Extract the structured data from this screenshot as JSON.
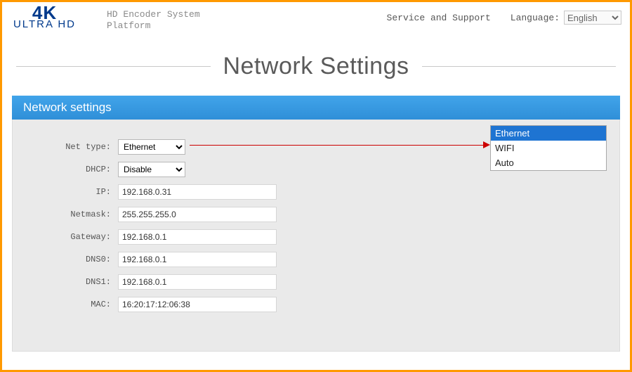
{
  "header": {
    "logo_top": "4K",
    "logo_bottom": "ULTRA HD",
    "platform_line1": "HD Encoder System",
    "platform_line2": "Platform",
    "service_link": "Service and Support",
    "language_label": "Language:",
    "language_value": "English"
  },
  "page_title": "Network Settings",
  "section_title": "Network settings",
  "form": {
    "net_type_label": "Net type:",
    "net_type_value": "Ethernet",
    "dhcp_label": "DHCP:",
    "dhcp_value": "Disable",
    "ip_label": "IP:",
    "ip_value": "192.168.0.31",
    "netmask_label": "Netmask:",
    "netmask_value": "255.255.255.0",
    "gateway_label": "Gateway:",
    "gateway_value": "192.168.0.1",
    "dns0_label": "DNS0:",
    "dns0_value": "192.168.0.1",
    "dns1_label": "DNS1:",
    "dns1_value": "192.168.0.1",
    "mac_label": "MAC:",
    "mac_value": "16:20:17:12:06:38"
  },
  "net_type_options": {
    "opt0": "Ethernet",
    "opt1": "WIFI",
    "opt2": "Auto"
  }
}
